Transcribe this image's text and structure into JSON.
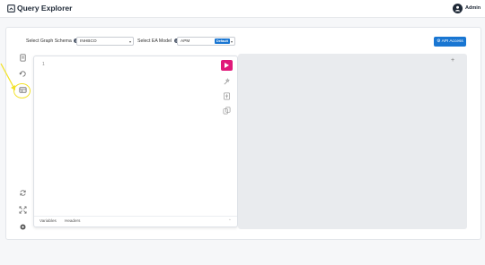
{
  "header": {
    "app_title": "Query Explorer",
    "user_name": "Admin"
  },
  "controls": {
    "graph_schema_label": "Select Graph Schema",
    "graph_schema_value": "INHBCO",
    "ea_model_label": "Select EA Model",
    "ea_model_value": "APM",
    "ea_model_badge": "Default",
    "api_access_label": "API Access"
  },
  "editor": {
    "line_number": "1",
    "tabs": [
      "Variables",
      "Headers"
    ],
    "run_color": "#e0197a"
  },
  "sidebar": {
    "icons": [
      "document-icon",
      "history-icon",
      "schema-icon",
      "refresh-icon",
      "expand-icon",
      "settings-icon"
    ]
  },
  "colors": {
    "accent": "#1976d2",
    "highlight": "#f2e229"
  }
}
